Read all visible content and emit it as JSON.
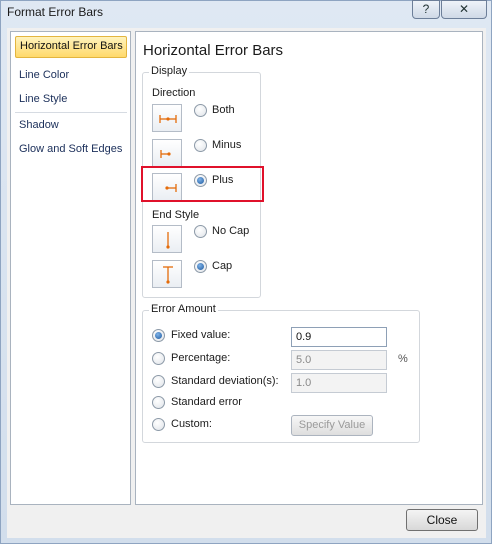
{
  "window": {
    "title": "Format Error Bars",
    "help_label": "?",
    "close_label": "✕"
  },
  "nav": {
    "items": [
      {
        "label": "Horizontal Error Bars",
        "selected": true
      },
      {
        "label": "Line Color"
      },
      {
        "label": "Line Style"
      },
      {
        "label": "Shadow"
      },
      {
        "label": "Glow and Soft Edges"
      }
    ]
  },
  "panel": {
    "title": "Horizontal Error Bars"
  },
  "display": {
    "group_label": "Display",
    "direction_label": "Direction",
    "direction_options": [
      {
        "label": "Both",
        "icon": "both-direction-icon",
        "selected": false
      },
      {
        "label": "Minus",
        "icon": "minus-direction-icon",
        "selected": false
      },
      {
        "label": "Plus",
        "icon": "plus-direction-icon",
        "selected": true
      }
    ],
    "end_style_label": "End Style",
    "end_style_options": [
      {
        "label": "No Cap",
        "icon": "no-cap-icon",
        "selected": false
      },
      {
        "label": "Cap",
        "icon": "cap-icon",
        "selected": true
      }
    ]
  },
  "error_amount": {
    "group_label": "Error Amount",
    "fixed": {
      "label": "Fixed value:",
      "value": "0.9",
      "selected": true
    },
    "percentage": {
      "label": "Percentage:",
      "value": "5.0",
      "unit": "%",
      "selected": false
    },
    "std_dev": {
      "label": "Standard deviation(s):",
      "value": "1.0",
      "selected": false
    },
    "std_error": {
      "label": "Standard error",
      "selected": false
    },
    "custom": {
      "label": "Custom:",
      "button_label": "Specify Value",
      "selected": false
    }
  },
  "footer": {
    "close_label": "Close"
  },
  "colors": {
    "accent_highlight": "#e0112b",
    "icon_orange": "#e46c0a",
    "selected_nav": "#ffd96b"
  }
}
